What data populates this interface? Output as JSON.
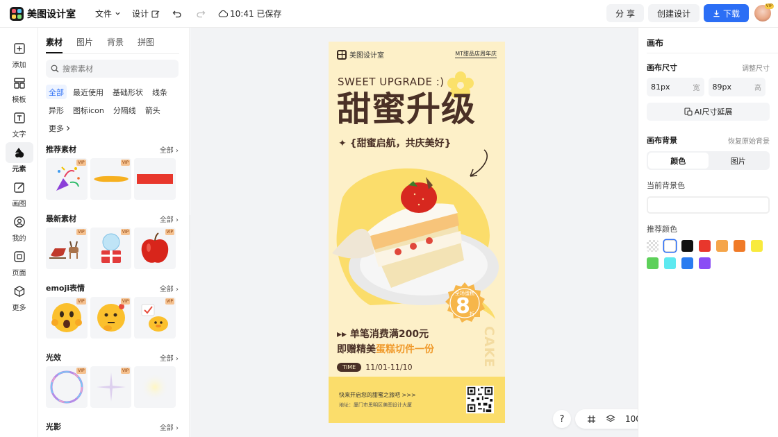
{
  "app": {
    "name": "美图设计室"
  },
  "topbar": {
    "menu_file": "文件",
    "menu_design": "设计",
    "save_status": "10:41 已保存",
    "share": "分 享",
    "create_design": "创建设计",
    "download": "下载",
    "avatar_badge": "VIP"
  },
  "rail": [
    {
      "label": "添加",
      "icon": "plus-square-icon"
    },
    {
      "label": "模板",
      "icon": "template-icon"
    },
    {
      "label": "文字",
      "icon": "text-icon"
    },
    {
      "label": "元素",
      "icon": "shapes-icon"
    },
    {
      "label": "画图",
      "icon": "draw-icon"
    },
    {
      "label": "我的",
      "icon": "user-icon"
    },
    {
      "label": "页面",
      "icon": "page-add-icon"
    },
    {
      "label": "更多",
      "icon": "cube-icon"
    }
  ],
  "panel": {
    "tabs": [
      "素材",
      "图片",
      "背景",
      "拼图"
    ],
    "search_placeholder": "搜索素材",
    "chips": [
      "全部",
      "最近使用",
      "基础形状",
      "线条",
      "异形",
      "图标icon",
      "分隔线",
      "箭头",
      "更多"
    ],
    "vip": "VIP",
    "all_label": "全部",
    "sections": [
      {
        "title": "推荐素材",
        "items": [
          "confetti-popper",
          "yellow-brush-stroke",
          "red-rectangle"
        ]
      },
      {
        "title": "最新素材",
        "items": [
          "reindeer-sleigh",
          "snow-globe-gift",
          "red-apple"
        ]
      },
      {
        "title": "emoji表情",
        "items": [
          "shocked-emoji",
          "thinking-emoji",
          "duck-emoji"
        ]
      },
      {
        "title": "光效",
        "items": [
          "bubble-light",
          "sparkle-light",
          "glow-light"
        ]
      },
      {
        "title": "光影",
        "items": []
      }
    ]
  },
  "poster": {
    "brand": "美图设计室",
    "tag": "MT甜品店周年庆",
    "subtitle_en": "SWEET UPGRADE :)",
    "headline": "甜蜜升级",
    "subline": "✦ {甜蜜启航，共庆美好}",
    "badge_top": "全场蛋糕",
    "badge_num": "8",
    "badge_unit": "折",
    "offer1": "▸▸ 单笔消费满200元",
    "offer2_a": "即赠精美",
    "offer2_b": "蛋糕切件一份",
    "time_label": "TIME",
    "dates": "11/01-11/10",
    "vertical": "CAKE",
    "footer1": "快来开启您的甜蜜之旅吧 >>>",
    "footer2": "地址：厦门市思明区美图设计大厦"
  },
  "zoombar": {
    "help": "?",
    "zoom": "100%"
  },
  "right": {
    "title": "画布",
    "size_label": "画布尺寸",
    "size_action": "调整尺寸",
    "width_value": "81px",
    "width_unit": "宽",
    "height_value": "89px",
    "height_unit": "高",
    "ai_button": "AI尺寸延展",
    "bg_label": "画布背景",
    "bg_action": "恢复原始背景",
    "seg_color": "颜色",
    "seg_image": "图片",
    "current_bg": "当前背景色",
    "recommend": "推荐颜色",
    "swatches": [
      "transparent",
      "#ffffff",
      "#111111",
      "#e8372c",
      "#f5a54a",
      "#f07a27",
      "#f8ea3d",
      "#5dd05a",
      "#5ee9f0",
      "#2b7cf0",
      "#8a4cf5"
    ]
  },
  "colors": {
    "accent": "#2b6ef5",
    "poster_bg": "#fdf0c8",
    "poster_text": "#4a3026",
    "poster_yellow": "#fbdd6b",
    "badge": "#f6b64a"
  }
}
